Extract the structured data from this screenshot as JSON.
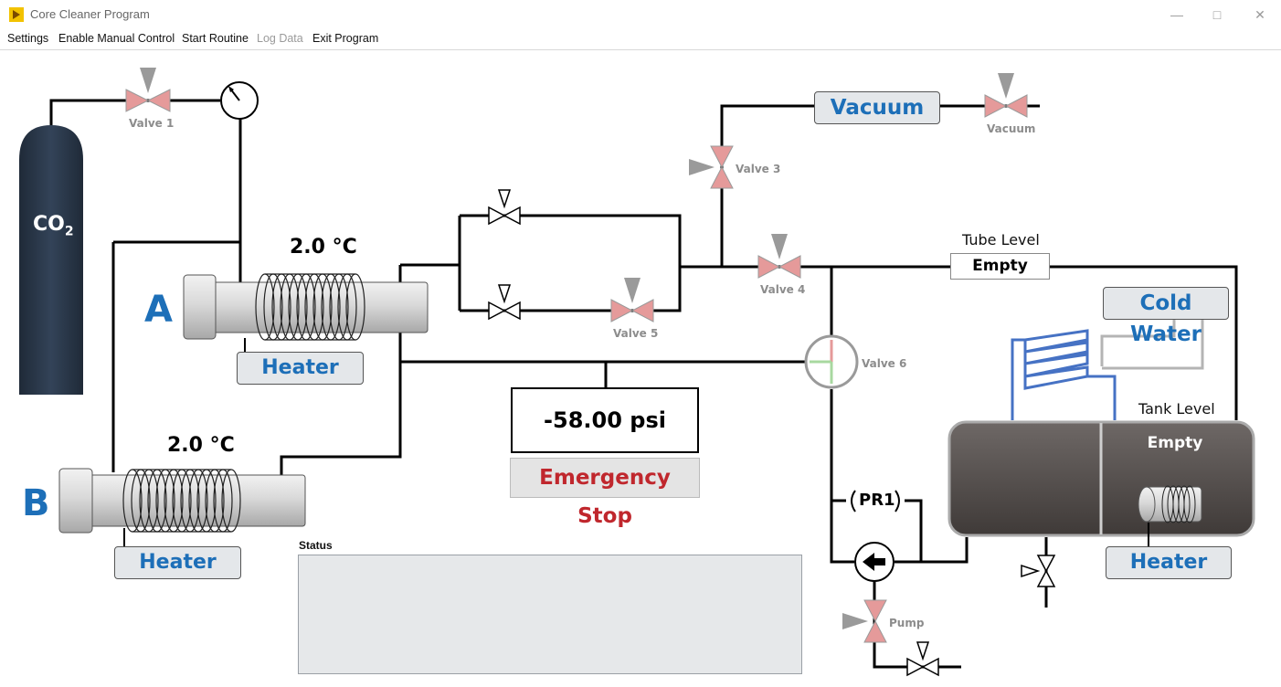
{
  "window": {
    "title": "Core Cleaner Program"
  },
  "menu": {
    "settings": "Settings",
    "manual": "Enable Manual Control",
    "start": "Start Routine",
    "log": "Log Data",
    "exit": "Exit Program"
  },
  "tank_co2": {
    "formula": "CO",
    "subscript": "2"
  },
  "valves": {
    "v1": "Valve 1",
    "v3": "Valve 3",
    "v4": "Valve 4",
    "v5": "Valve 5",
    "v6": "Valve 6",
    "vacuum": "Vacuum",
    "pump": "Pump"
  },
  "chamber_a": {
    "letter": "A",
    "temp": "2.0 °C",
    "heater_label": "Heater"
  },
  "chamber_b": {
    "letter": "B",
    "temp": "2.0 °C",
    "heater_label": "Heater"
  },
  "vacuum_button": "Vacuum",
  "cold_water_button": "Cold Water",
  "tube_level": {
    "label": "Tube Level",
    "value": "Empty"
  },
  "tank_level": {
    "label": "Tank Level",
    "value": "Empty",
    "heater_label": "Heater"
  },
  "pressure": {
    "value": "-58.00 psi"
  },
  "emergency_stop": "Emergency Stop",
  "pr1": "PR1",
  "status": {
    "label": "Status",
    "text": ""
  },
  "colors": {
    "accent_blue": "#1d6fb8",
    "stop_red": "#c0272d",
    "valve_pink": "#e59a9a",
    "valve_gray": "#9a9a9a"
  }
}
